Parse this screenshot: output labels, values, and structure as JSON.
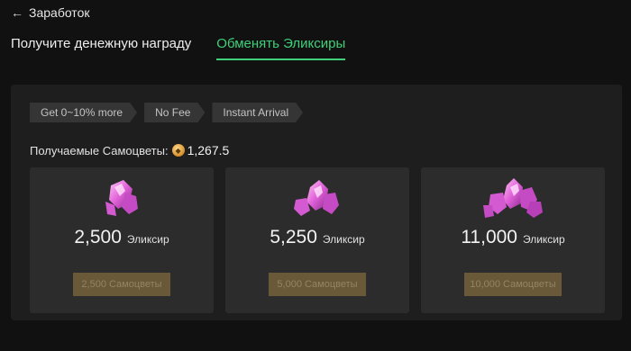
{
  "header": {
    "back_arrow": "←",
    "back_label": "Заработок"
  },
  "tabs": [
    {
      "label": "Получите денежную награду",
      "active": false
    },
    {
      "label": "Обменять Эликсиры",
      "active": true
    }
  ],
  "tags": [
    "Get 0~10% more",
    "No Fee",
    "Instant Arrival"
  ],
  "gems": {
    "label": "Получаемые Самоцветы:",
    "icon": "gem-coin-icon",
    "value": "1,267.5"
  },
  "offers": [
    {
      "amount": "2,500",
      "unit": "Эликсир",
      "price": "2,500 Самоцветы",
      "icon": "elixir-crystal-small-icon"
    },
    {
      "amount": "5,250",
      "unit": "Эликсир",
      "price": "5,000 Самоцветы",
      "icon": "elixir-crystal-medium-icon"
    },
    {
      "amount": "11,000",
      "unit": "Эликсир",
      "price": "10,000 Самоцветы",
      "icon": "elixir-crystal-large-icon"
    }
  ],
  "colors": {
    "accent": "#3fd07a",
    "panel": "#1e1e1e",
    "card": "#2c2c2c",
    "button": "#695939",
    "crystal": "#e060d8"
  }
}
